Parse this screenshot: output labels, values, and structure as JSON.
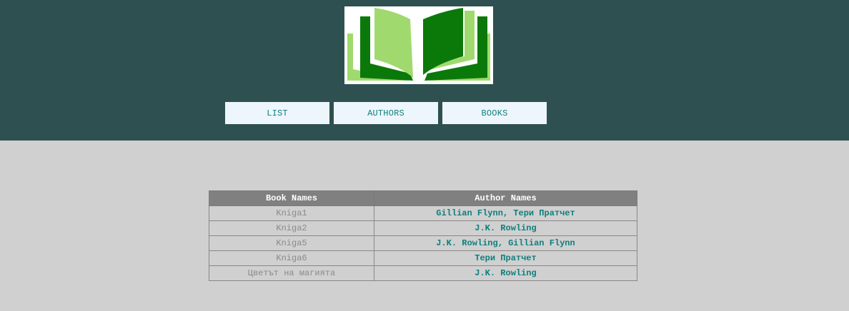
{
  "header": {
    "logo_icon": "open-book-logo",
    "colors": {
      "background": "#2f5050",
      "accent": "#0e7f7d"
    }
  },
  "nav": {
    "items": [
      {
        "label": "LIST"
      },
      {
        "label": "AUTHORS"
      },
      {
        "label": "BOOKS"
      }
    ]
  },
  "table": {
    "headers": [
      "Book Names",
      "Author Names"
    ],
    "rows": [
      {
        "book": "Kniga1",
        "authors": "Gillian Flynn, Тери Пратчет"
      },
      {
        "book": "Kniga2",
        "authors": "J.K. Rowling"
      },
      {
        "book": "Kniga5",
        "authors": "J.K. Rowling, Gillian Flynn"
      },
      {
        "book": "Kniga6",
        "authors": "Тери Пратчет"
      },
      {
        "book": "Цветът на магията",
        "authors": "J.K. Rowling"
      }
    ]
  }
}
